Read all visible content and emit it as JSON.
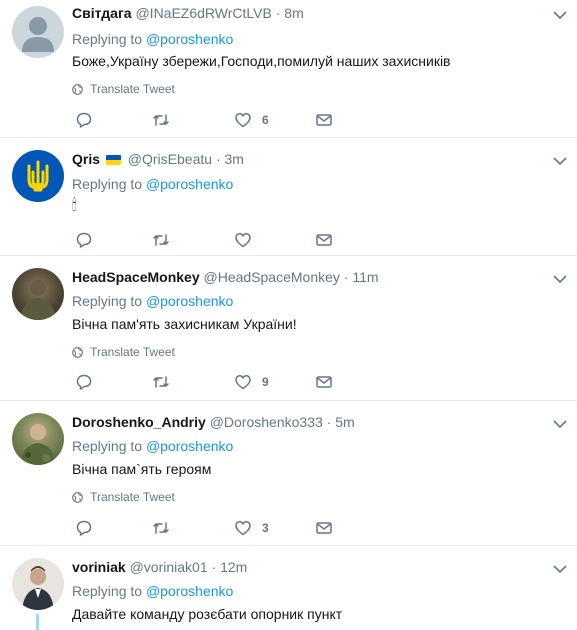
{
  "tweets": [
    {
      "name": "Світдага",
      "handle": "@INaEZ6dRWrCtLVB",
      "dot": "·",
      "time": "8m",
      "replying_prefix": "Replying to",
      "replying_to": "@poroshenko",
      "text": "Боже,Україну збережи,Господи,помилуй наших захисників",
      "translate": "Translate Tweet",
      "likes": "6"
    },
    {
      "name": "Qris",
      "handle": "@QrisEbeatu",
      "dot": "·",
      "time": "3m",
      "replying_prefix": "Replying to",
      "replying_to": "@poroshenko",
      "text": "🕯",
      "likes": ""
    },
    {
      "name": "HeadSpaceMonkey",
      "handle": "@HeadSpaceMonkey",
      "dot": "·",
      "time": "11m",
      "replying_prefix": "Replying to",
      "replying_to": "@poroshenko",
      "text": "Вічна пам'ять захисникам України!",
      "translate": "Translate Tweet",
      "likes": "9"
    },
    {
      "name": "Doroshenko_Andriy",
      "handle": "@Doroshenko333",
      "dot": "·",
      "time": "5m",
      "replying_prefix": "Replying to",
      "replying_to": "@poroshenko",
      "text": "Вічна пам`ять героям",
      "translate": "Translate Tweet",
      "likes": "3"
    },
    {
      "name": "voriniak",
      "handle": "@voriniak01",
      "dot": "·",
      "time": "12m",
      "replying_prefix": "Replying to",
      "replying_to": "@poroshenko",
      "text": "Давайте команду розєбати опорник пункт"
    }
  ],
  "colors": {
    "link": "#1b95e0",
    "secondary_text": "#657786",
    "divider": "#e6ecf0",
    "thread_line": "#a3d3f5"
  }
}
